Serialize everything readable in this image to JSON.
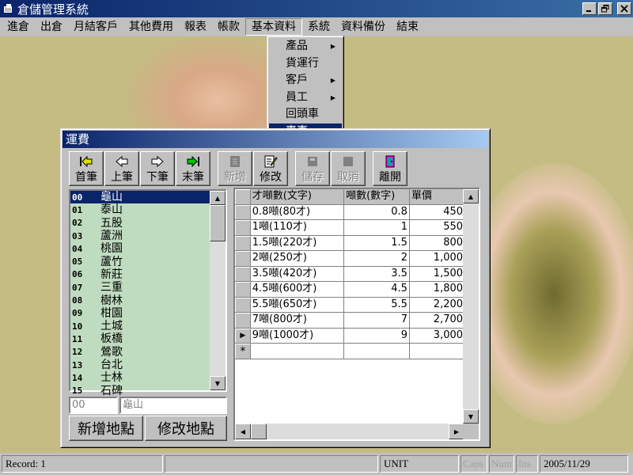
{
  "window": {
    "title": "倉儲管理系統"
  },
  "menubar": [
    "進倉",
    "出倉",
    "月結客戶",
    "其他費用",
    "報表",
    "帳款",
    "基本資料",
    "系統",
    "資料備份",
    "結束"
  ],
  "dropdown": [
    {
      "label": "產品",
      "submenu": true
    },
    {
      "label": "貨運行",
      "submenu": false
    },
    {
      "label": "客戶",
      "submenu": true
    },
    {
      "label": "員工",
      "submenu": true
    },
    {
      "label": "回頭車",
      "submenu": false
    },
    {
      "label": "專車",
      "submenu": false,
      "selected": true
    }
  ],
  "child": {
    "title": "運費",
    "toolbar": [
      {
        "label": "首筆",
        "icon": "first-record-icon",
        "enabled": true
      },
      {
        "label": "上筆",
        "icon": "prev-record-icon",
        "enabled": true
      },
      {
        "label": "下筆",
        "icon": "next-record-icon",
        "enabled": true
      },
      {
        "label": "末筆",
        "icon": "last-record-icon",
        "enabled": true
      },
      {
        "label": "新增",
        "icon": "add-record-icon",
        "enabled": false
      },
      {
        "label": "修改",
        "icon": "edit-record-icon",
        "enabled": true
      },
      {
        "label": "儲存",
        "icon": "save-icon",
        "enabled": false
      },
      {
        "label": "取消",
        "icon": "cancel-icon",
        "enabled": false
      },
      {
        "label": "離開",
        "icon": "exit-door-icon",
        "enabled": true
      }
    ],
    "locations": [
      {
        "code": "00",
        "name": "龜山"
      },
      {
        "code": "01",
        "name": "泰山"
      },
      {
        "code": "02",
        "name": "五股"
      },
      {
        "code": "03",
        "name": "蘆洲"
      },
      {
        "code": "04",
        "name": "桃園"
      },
      {
        "code": "05",
        "name": "蘆竹"
      },
      {
        "code": "06",
        "name": "新莊"
      },
      {
        "code": "07",
        "name": "三重"
      },
      {
        "code": "08",
        "name": "樹林"
      },
      {
        "code": "09",
        "name": "柑園"
      },
      {
        "code": "10",
        "name": "土城"
      },
      {
        "code": "11",
        "name": "板橋"
      },
      {
        "code": "12",
        "name": "鶯歌"
      },
      {
        "code": "13",
        "name": "台北"
      },
      {
        "code": "14",
        "name": "士林"
      },
      {
        "code": "15",
        "name": "石碑"
      }
    ],
    "code_field": "00",
    "name_field": "龜山",
    "add_location_label": "新增地點",
    "edit_location_label": "修改地點",
    "grid": {
      "columns": [
        "才噸數(文字)",
        "噸數(數字)",
        "單價"
      ],
      "rows": [
        [
          "0.8噸(80才)",
          "0.8",
          "450"
        ],
        [
          "1噸(110才)",
          "1",
          "550"
        ],
        [
          "1.5噸(220才)",
          "1.5",
          "800"
        ],
        [
          "2噸(250才)",
          "2",
          "1,000"
        ],
        [
          "3.5噸(420才)",
          "3.5",
          "1,500"
        ],
        [
          "4.5噸(600才)",
          "4.5",
          "1,800"
        ],
        [
          "5.5噸(650才)",
          "5.5",
          "2,200"
        ],
        [
          "7噸(800才)",
          "7",
          "2,700"
        ],
        [
          "9噸(1000才)",
          "9",
          "3,000"
        ]
      ],
      "current_row": 8,
      "new_row_marker": "*"
    }
  },
  "status": {
    "record": "Record: 1",
    "unit": "UNIT",
    "caps": "Caps",
    "num": "Num",
    "ins": "Ins",
    "date": "2005/11/29"
  }
}
